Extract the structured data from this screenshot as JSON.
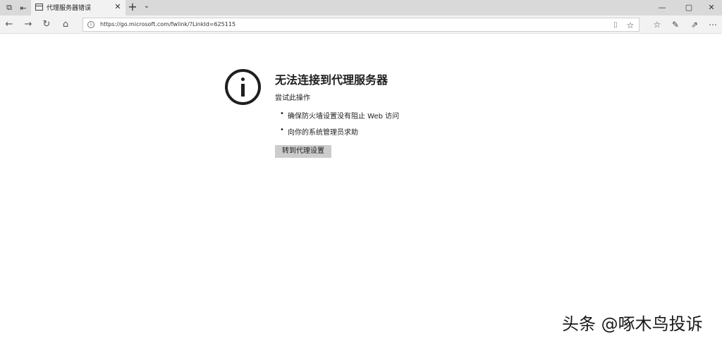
{
  "browser": {
    "tab": {
      "title": "代理服务器错误",
      "close_glyph": "✕"
    },
    "new_tab_glyph": "+",
    "tab_list_glyph": "⌄",
    "window_controls": {
      "minimize": "—",
      "maximize": "▢",
      "close": "✕"
    },
    "nav": {
      "back": "←",
      "forward": "→",
      "refresh": "↻",
      "home": "⌂"
    },
    "address": {
      "url": "https://go.microsoft.com/fwlink/?LinkId=625115",
      "info_glyph": "i"
    },
    "icons": {
      "reading_view": "reading-view-icon",
      "favorite": "star-icon",
      "favorites_hub": "favorites-hub-icon",
      "notes": "pen-icon",
      "share": "share-icon",
      "more": "more-icon"
    }
  },
  "error_page": {
    "title": "无法连接到代理服务器",
    "subtitle": "尝试此操作",
    "bullets": [
      "确保防火墙设置没有阻止 Web 访问",
      "向你的系统管理员求助"
    ],
    "button_label": "转到代理设置"
  },
  "watermark": "头条 @啄木鸟投诉"
}
